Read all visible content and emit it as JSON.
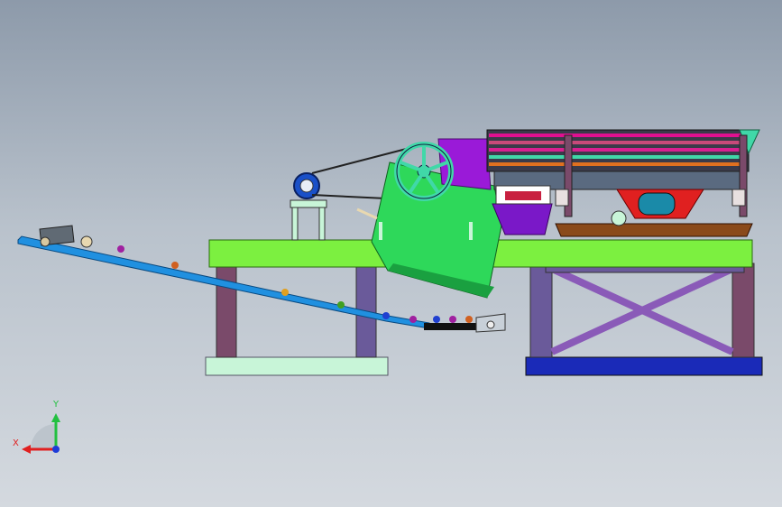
{
  "triad": {
    "x_label": "X",
    "y_label": "Y",
    "x_color": "#e02020",
    "y_color": "#22c040",
    "z_color": "#1e3cd8"
  },
  "colors": {
    "platform": "#7cf040",
    "legs": "#7a4a6a",
    "left_base": "#c8f5d8",
    "right_base": "#1a2ab8",
    "crusher_body": "#2ed85a",
    "flywheel": "#40d8a8",
    "hopper_purple": "#9a1ad8",
    "screen_red": "#d82090",
    "conveyor": "#2090e0",
    "motor": "#1a50c8",
    "feeder_brown": "#8a4a1a"
  }
}
